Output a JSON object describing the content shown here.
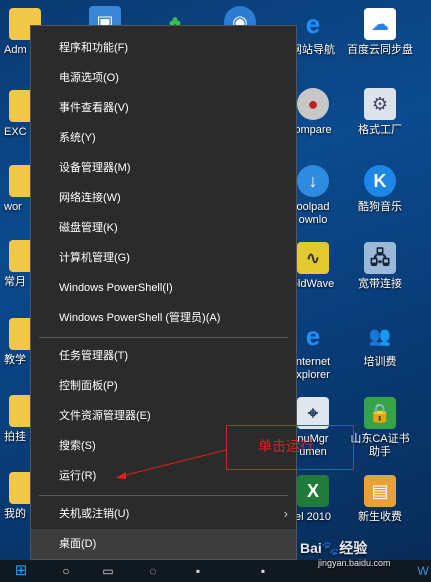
{
  "menu": {
    "items": [
      {
        "label": "程序和功能(F)"
      },
      {
        "label": "电源选项(O)"
      },
      {
        "label": "事件查看器(V)"
      },
      {
        "label": "系统(Y)"
      },
      {
        "label": "设备管理器(M)"
      },
      {
        "label": "网络连接(W)"
      },
      {
        "label": "磁盘管理(K)"
      },
      {
        "label": "计算机管理(G)"
      },
      {
        "label": "Windows PowerShell(I)"
      },
      {
        "label": "Windows PowerShell (管理员)(A)"
      },
      {
        "label": "任务管理器(T)"
      },
      {
        "label": "控制面板(P)"
      },
      {
        "label": "文件资源管理器(E)"
      },
      {
        "label": "搜索(S)"
      },
      {
        "label": "运行(R)"
      },
      {
        "label": "关机或注销(U)"
      },
      {
        "label": "桌面(D)"
      }
    ]
  },
  "annotation": {
    "text": "单击运行",
    "color": "#e02020"
  },
  "desktop": {
    "left_labels": [
      "Adm",
      "EXC",
      "wor",
      "常月",
      "教学",
      "拍挂",
      "我的"
    ],
    "right_icons": [
      {
        "label": "网站导航",
        "icon": "ie-icon"
      },
      {
        "label": "百度云同步盘",
        "icon": "cloud-icon"
      },
      {
        "label": "ompare",
        "icon": "disc-icon"
      },
      {
        "label": "格式工厂",
        "icon": "format-factory-icon"
      },
      {
        "label": "oolpad",
        "label2": "ownlo",
        "icon": "download-icon"
      },
      {
        "label": "酷狗音乐",
        "icon": "kugou-icon"
      },
      {
        "label": "oldWave",
        "icon": "goldwave-icon"
      },
      {
        "label": "宽带连接",
        "icon": "network-icon"
      },
      {
        "label": "nternet",
        "label2": "xplorer",
        "icon": "ie-icon"
      },
      {
        "label": "培训费",
        "icon": "users-icon"
      },
      {
        "label": "nuMgr",
        "label2": "umen",
        "icon": "mouse-icon"
      },
      {
        "label": "山东CA证书",
        "label2": "助手",
        "icon": "lock-icon"
      },
      {
        "label": "el 2010",
        "icon": "excel-icon"
      },
      {
        "label": "新生收费",
        "icon": "box-icon"
      }
    ]
  },
  "watermark": {
    "brand": "Bai",
    "brand2": "经验",
    "url": "jingyan.baidu.com"
  },
  "colors": {
    "menu_bg": "#2b2b2b",
    "menu_hl": "#3d3d3d",
    "desktop": "#0b4b8f"
  }
}
